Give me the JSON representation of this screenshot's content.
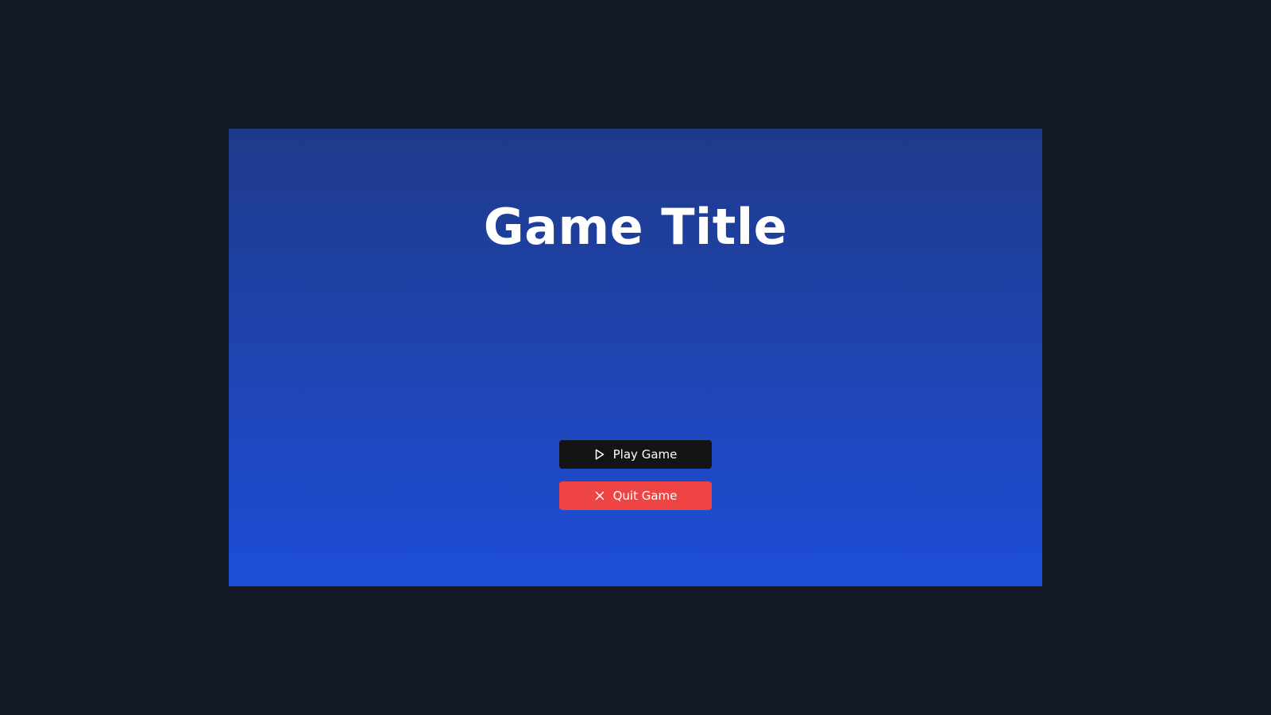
{
  "game": {
    "title": "Game Title"
  },
  "menu": {
    "play_label": "Play Game",
    "play_icon": "play-icon",
    "quit_label": "Quit Game",
    "quit_icon": "close-icon"
  },
  "colors": {
    "page_background": "#121826",
    "screen_gradient_top": "#1f3a8a",
    "screen_gradient_bottom": "#1d4ed8",
    "play_button": "#141416",
    "quit_button": "#ef4444",
    "text": "#ffffff"
  }
}
